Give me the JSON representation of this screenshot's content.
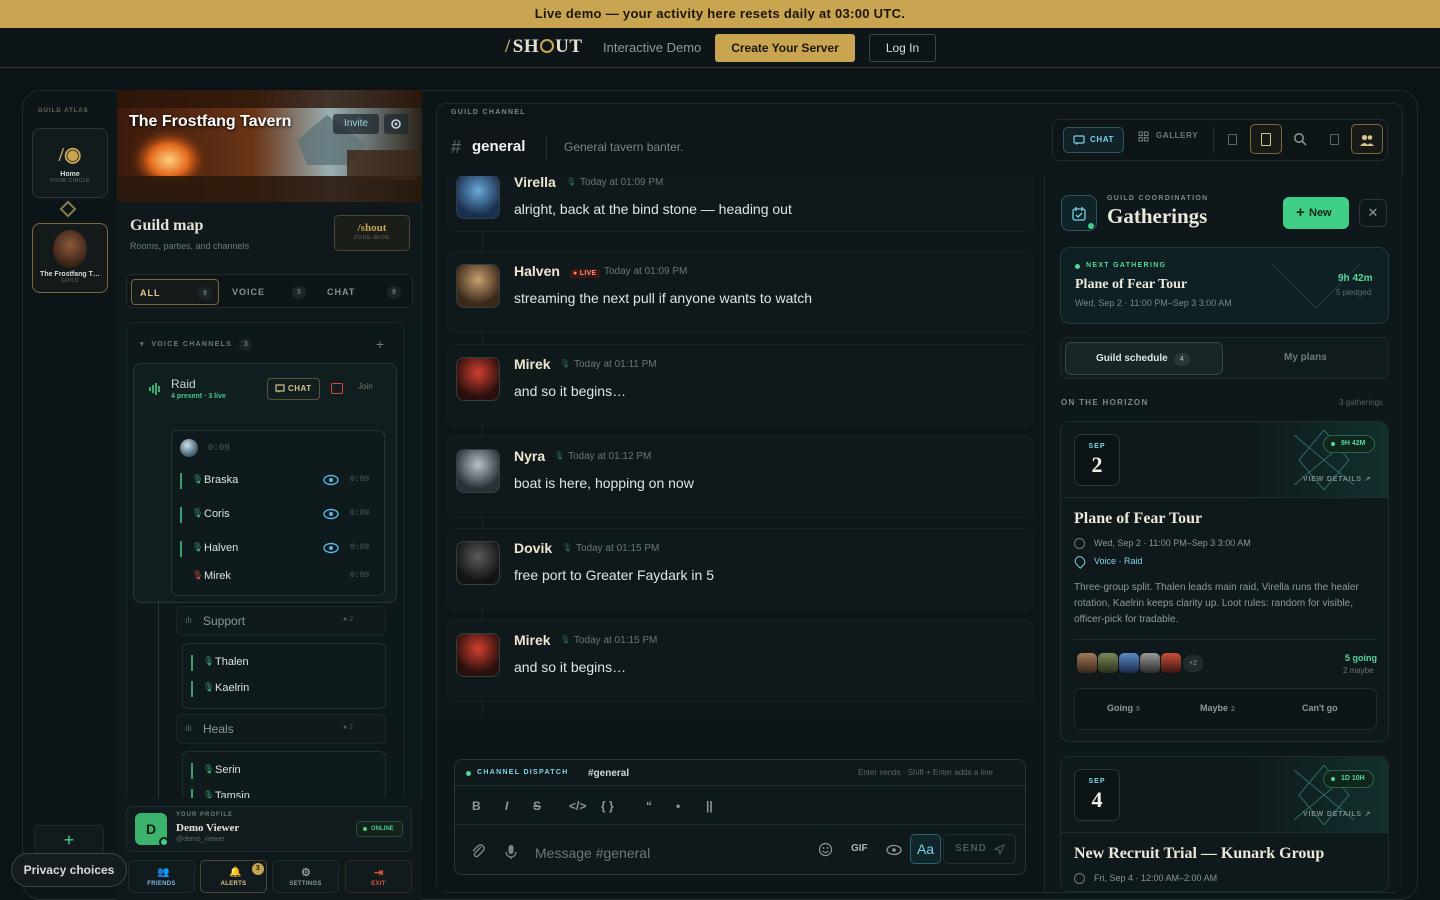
{
  "banner": {
    "text": "Live demo — your activity here resets daily at 03:00 UTC."
  },
  "topbar": {
    "logo": "SH UT",
    "demo_label": "Interactive Demo",
    "create_label": "Create Your Server",
    "login_label": "Log In"
  },
  "rail": {
    "title": "GUILD ATLAS",
    "home": {
      "label": "Home",
      "sub": "YOUR CIRCLE"
    },
    "guild": {
      "label": "The Frostfang T…",
      "sub": "GUILD"
    }
  },
  "guild": {
    "name": "The Frostfang Tavern",
    "invite_label": "Invite",
    "map_title": "Guild map",
    "map_sub": "Rooms, parties, and channels",
    "shout_btn": "/shout",
    "shout_sub": "ZONE-WIDE",
    "filters": [
      {
        "label": "ALL",
        "count": "9"
      },
      {
        "label": "VOICE",
        "count": "5"
      },
      {
        "label": "CHAT",
        "count": "9"
      }
    ],
    "voice_header": "VOICE CHANNELS",
    "voice_count": "3",
    "raid": {
      "name": "Raid",
      "sub": "4 present · 3 live",
      "chat_label": "CHAT",
      "join_label": "Join",
      "timer": "0:09",
      "members": [
        {
          "name": "Braska",
          "time": "0:09"
        },
        {
          "name": "Coris",
          "time": "0:09"
        },
        {
          "name": "Halven",
          "time": "0:09"
        },
        {
          "name": "Mirek",
          "time": "0:09"
        }
      ]
    },
    "support": {
      "name": "Support",
      "count": "2",
      "members": [
        "Thalen",
        "Kaelrin"
      ]
    },
    "heals": {
      "name": "Heals",
      "count": "2",
      "members": [
        "Serin",
        "Tamsin"
      ]
    }
  },
  "profile": {
    "label": "YOUR PROFILE",
    "name": "Demo Viewer",
    "handle": "@demo_viewer",
    "status": "ONLINE",
    "nav": [
      {
        "label": "FRIENDS"
      },
      {
        "label": "ALERTS",
        "badge": "3"
      },
      {
        "label": "SETTINGS"
      },
      {
        "label": "EXIT"
      }
    ]
  },
  "privacy": {
    "label": "Privacy choices"
  },
  "channel": {
    "label": "GUILD CHANNEL",
    "name": "general",
    "topic": "General tavern banter.",
    "tools": {
      "chat": "CHAT",
      "gallery": "GALLERY"
    }
  },
  "messages": [
    {
      "author": "Virella",
      "time": "Today at 01:09 PM",
      "text": "alright, back at the bind stone — heading out",
      "live": ""
    },
    {
      "author": "Halven",
      "time": "Today at 01:09 PM",
      "text": "streaming the next pull if anyone wants to watch",
      "live": "LIVE"
    },
    {
      "author": "Mirek",
      "time": "Today at 01:11 PM",
      "text": "and so it begins…",
      "live": ""
    },
    {
      "author": "Nyra",
      "time": "Today at 01:12 PM",
      "text": "boat is here, hopping on now",
      "live": ""
    },
    {
      "author": "Dovik",
      "time": "Today at 01:15 PM",
      "text": "free port to Greater Faydark in 5",
      "live": ""
    },
    {
      "author": "Mirek",
      "time": "Today at 01:15 PM",
      "text": "and so it begins…",
      "live": ""
    }
  ],
  "composer": {
    "label": "CHANNEL DISPATCH",
    "channel": "#general",
    "hint": "Enter sends · Shift + Enter adds a line",
    "placeholder": "Message #general",
    "gif": "GIF",
    "aa": "Aa",
    "send": "SEND",
    "tools": [
      "B",
      "I",
      "S",
      "</>",
      "{ }",
      "“",
      "•",
      "||"
    ]
  },
  "gatherings": {
    "overline": "GUILD COORDINATION",
    "title": "Gatherings",
    "new_label": "New",
    "next": {
      "label": "NEXT GATHERING",
      "title": "Plane of Fear Tour",
      "date": "Wed, Sep 2 · 11:00 PM–Sep 3 3:00 AM",
      "countdown": "9h 42m",
      "pledged": "5 pledged"
    },
    "seg": {
      "schedule": "Guild schedule",
      "schedule_count": "4",
      "plans": "My plans"
    },
    "horizon_label": "ON THE HORIZON",
    "horizon_count": "3 gatherings",
    "events": [
      {
        "month": "SEP",
        "day": "2",
        "pill": "9H 42M",
        "details": "VIEW DETAILS",
        "title": "Plane of Fear Tour",
        "date": "Wed, Sep 2 · 11:00 PM–Sep 3 3:00 AM",
        "location": "Voice · Raid",
        "desc": "Three-group split. Thalen leads main raid, Virella runs the healer rotation, Kaelrin keeps clarity up. Loot rules: random for visible, officer-pick for tradable.",
        "extra": "+2",
        "going": "5 going",
        "maybe": "2 maybe",
        "rsvp": [
          {
            "label": "Going",
            "count": "5"
          },
          {
            "label": "Maybe",
            "count": "2"
          },
          {
            "label": "Can't go",
            "count": ""
          }
        ]
      },
      {
        "month": "SEP",
        "day": "4",
        "pill": "1D 10H",
        "details": "VIEW DETAILS",
        "title": "New Recruit Trial — Kunark Group",
        "date": "Fri, Sep 4 · 12:00 AM–2:00 AM"
      }
    ]
  },
  "colors": {
    "gold": "#c9a552",
    "green": "#3fcf86",
    "cyan": "#7ad2e6",
    "bg": "#0b1317"
  }
}
